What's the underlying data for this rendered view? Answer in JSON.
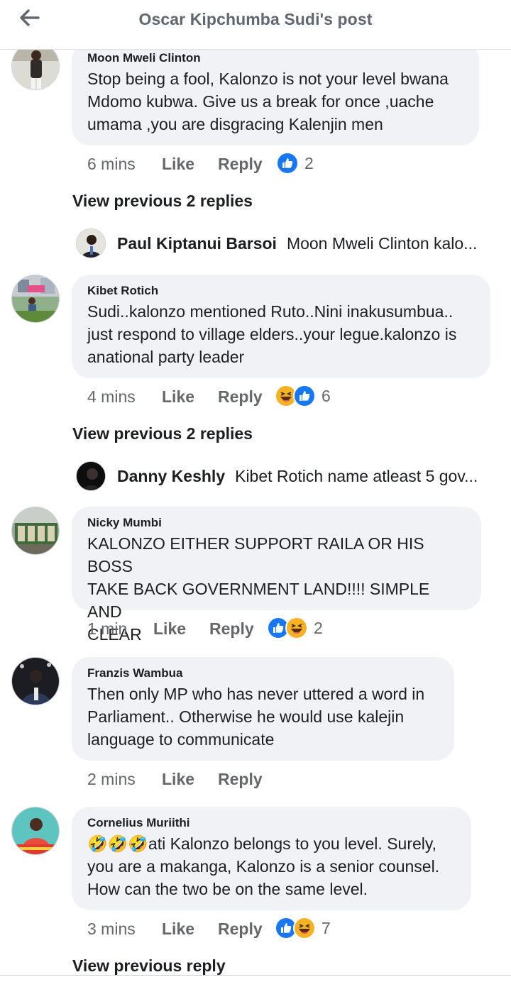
{
  "header": {
    "title": "Oscar Kipchumba Sudi's post",
    "back_icon": "arrow-left-icon"
  },
  "colors": {
    "like_blue": "#1877f2",
    "haha_yellow": "#f7b125",
    "bubble_bg": "#f0f2f5",
    "meta_gray": "#65676b"
  },
  "comments": [
    {
      "author": "Moon Mweli Clinton",
      "text": "Stop being a fool, Kalonzo is not your level bwana\nMdomo kubwa. Give us a break for once ,uache\numama ,you are disgracing Kalenjin men",
      "time": "6 mins",
      "like": "Like",
      "reply": "Reply",
      "reactions": [
        "like"
      ],
      "reaction_count": "2"
    },
    {
      "author": "Kibet Rotich",
      "text": "Sudi..kalonzo mentioned Ruto..Nini inakusumbua..\njust respond to village elders..your legue.kalonzo is\nanational party leader",
      "time": "4 mins",
      "like": "Like",
      "reply": "Reply",
      "reactions": [
        "haha",
        "like"
      ],
      "reaction_count": "6"
    },
    {
      "author": "Nicky Mumbi",
      "text": "KALONZO EITHER SUPPORT RAILA OR HIS BOSS\nTAKE BACK GOVERNMENT LAND!!!! SIMPLE AND\nCLEAR",
      "time": "1 min",
      "like": "Like",
      "reply": "Reply",
      "reactions": [
        "like",
        "haha"
      ],
      "reaction_count": "2"
    },
    {
      "author": "Franzis Wambua",
      "text": "Then only MP who has never uttered a word in\nParliament.. Otherwise he would use kalejin\nlanguage to communicate",
      "time": "2 mins",
      "like": "Like",
      "reply": "Reply",
      "reactions": [],
      "reaction_count": ""
    },
    {
      "author": "Cornelius Muriithi",
      "emoji_prefix": "🤣🤣🤣",
      "text": "ati Kalonzo belongs to you level. Surely,\nyou are a makanga, Kalonzo is a senior counsel.\nHow can the two be on the same level.",
      "time": "3 mins",
      "like": "Like",
      "reply": "Reply",
      "reactions": [
        "like",
        "haha"
      ],
      "reaction_count": "7"
    }
  ],
  "view_previous": [
    "View previous 2 replies",
    "View previous 2 replies",
    "View previous reply"
  ],
  "replies": [
    {
      "author": "Paul Kiptanui Barsoi",
      "text": "Moon Mweli Clinton kalo..."
    },
    {
      "author": "Danny Keshly",
      "text": "Kibet Rotich name atleast 5 gov..."
    }
  ]
}
